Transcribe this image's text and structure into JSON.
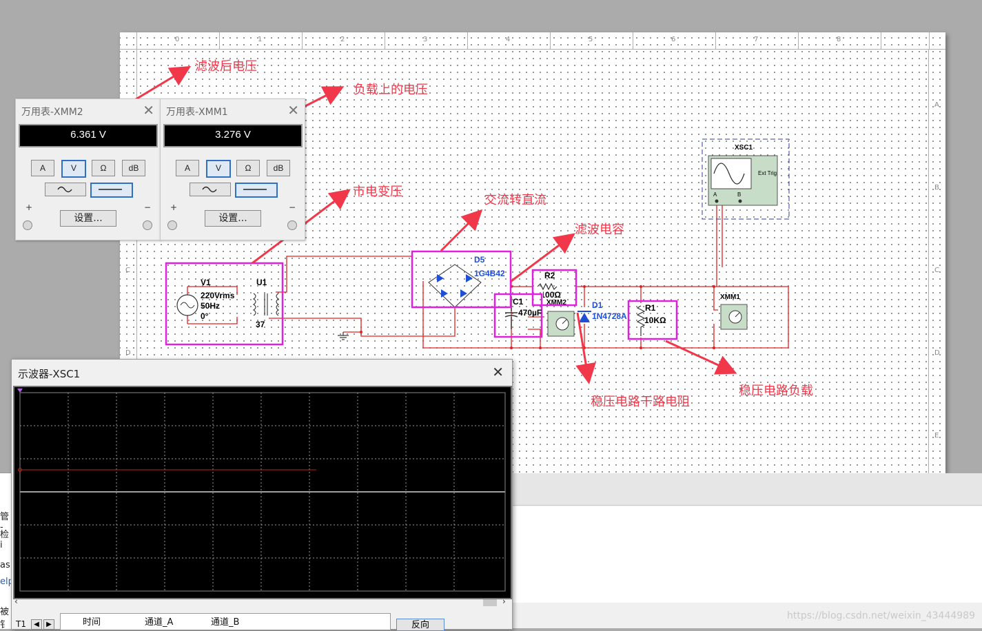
{
  "ruler": {
    "columns": [
      "0",
      "1",
      "2",
      "3",
      "4",
      "5",
      "6",
      "7",
      "8"
    ],
    "rows": [
      "A",
      "B",
      "C",
      "D",
      "E"
    ]
  },
  "annotations": {
    "filtered_voltage": "滤波后电压",
    "load_voltage": "负载上的电压",
    "mains_transformer": "市电变压",
    "ac_to_dc": "交流转直流",
    "filter_capacitor": "滤波电容",
    "regulator_series_resistor": "稳压电路干路电阻",
    "regulator_load": "稳压电路负载"
  },
  "components": {
    "v1": {
      "name": "V1",
      "rating": "220Vrms",
      "freq": "50Hz",
      "phase": "0°"
    },
    "u1": {
      "name": "U1",
      "ratio": "37"
    },
    "d5": {
      "name": "D5",
      "part": "1G4B42"
    },
    "c1": {
      "name": "C1",
      "value": "470µF"
    },
    "r2": {
      "name": "R2",
      "value": "100Ω"
    },
    "d1": {
      "name": "D1",
      "part": "1N4728A"
    },
    "r1": {
      "name": "R1",
      "value": "10KΩ"
    },
    "xmm2": {
      "name": "XMM2"
    },
    "xmm1": {
      "name": "XMM1"
    },
    "xsc1": {
      "name": "XSC1",
      "ext_trig": "Ext Trig",
      "chan_a": "A",
      "chan_b": "B"
    }
  },
  "multimeters": [
    {
      "title": "万用表-XMM2",
      "reading": "6.361 V",
      "buttons": [
        "A",
        "V",
        "Ω",
        "dB"
      ],
      "selected": "V",
      "settings": "设置...",
      "plus": "+",
      "minus": "−"
    },
    {
      "title": "万用表-XMM1",
      "reading": "3.276 V",
      "buttons": [
        "A",
        "V",
        "Ω",
        "dB"
      ],
      "selected": "V",
      "settings": "设置...",
      "plus": "+",
      "minus": "−"
    }
  ],
  "oscilloscope": {
    "title": "示波器-XSC1",
    "table_headers": [
      "时间",
      "通道_A",
      "通道_B"
    ],
    "t1": "T1",
    "reverse_button": "反向"
  },
  "left_panel_fragments": [
    "管 -",
    "检i",
    "as",
    "elp",
    "被钅"
  ],
  "watermark": "https://blog.csdn.net/weixin_43444989",
  "colors": {
    "wire": "#e02020",
    "highlight": "#e020e0",
    "arrow": "#f0384a",
    "diode": "#1f4fd6",
    "scope_bg": "#000000",
    "trace": "#c02020"
  }
}
